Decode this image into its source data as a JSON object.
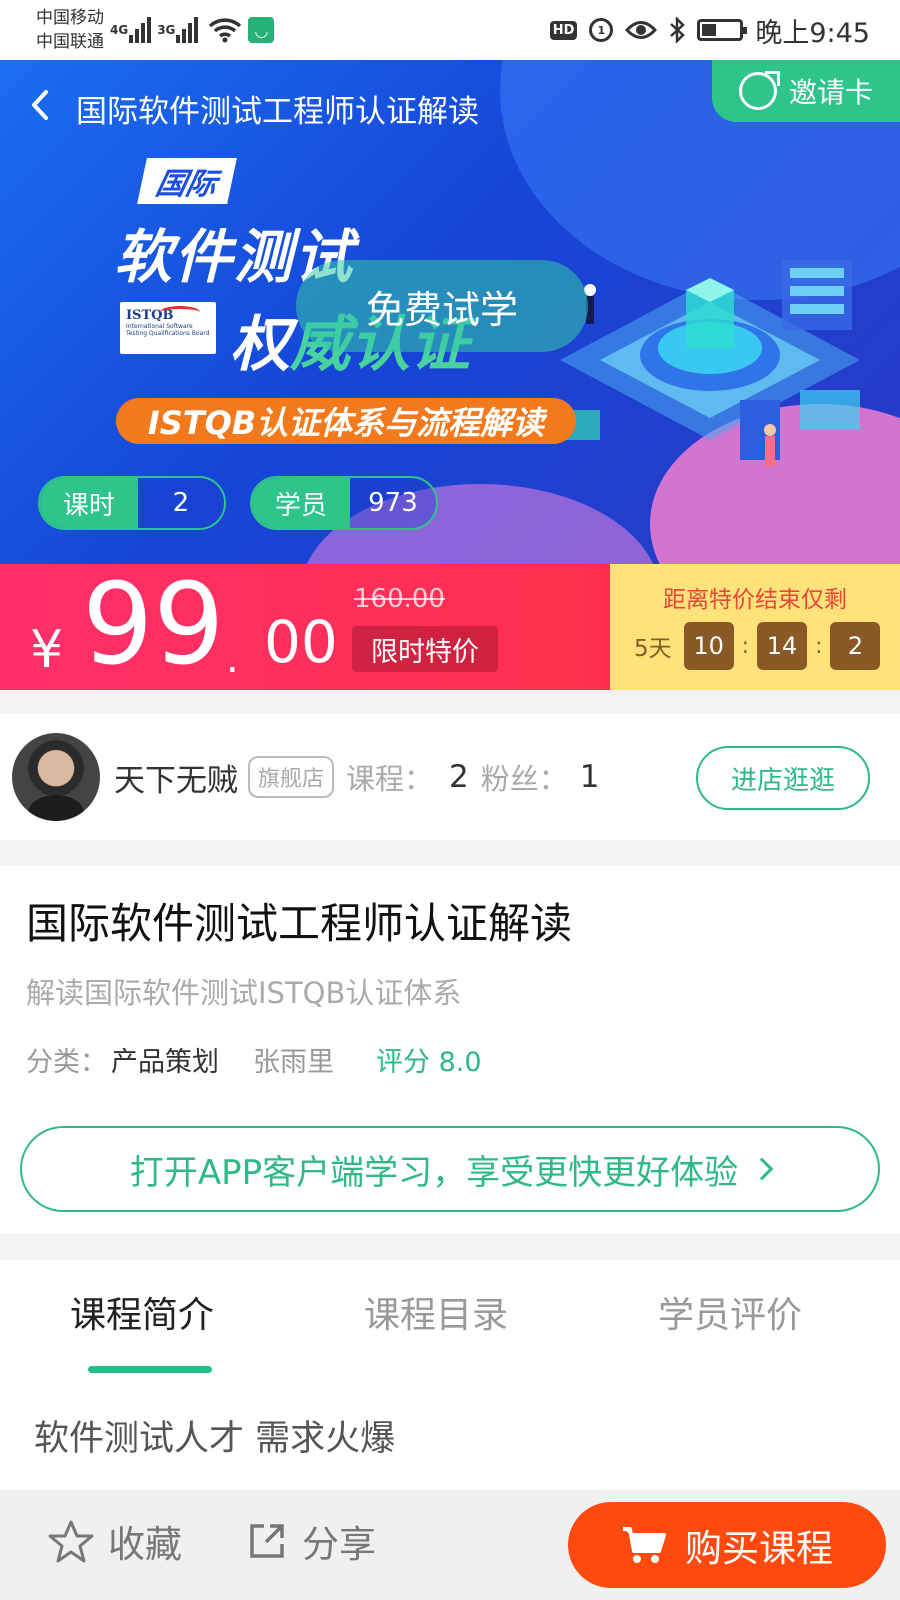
{
  "status_bar": {
    "carrier1": "中国移动",
    "carrier2": "中国联通",
    "net1": "4G",
    "net2": "3G",
    "hd": "HD",
    "time": "晚上9:45"
  },
  "hero": {
    "title": "国际软件测试工程师认证解读",
    "invite_label": "邀请卡",
    "banner_badge": "国际",
    "banner_line1": "软件测试",
    "banner_line2a": "权",
    "banner_line2b": "威认证",
    "istqb_logo": "ISTQB",
    "istqb_sub": "International Software Testing Qualifications Board",
    "trial_label": "免费试学",
    "banner_tagline": "ISTQB认证体系与流程解读",
    "lessons_label": "课时",
    "lessons_value": "2",
    "students_label": "学员",
    "students_value": "973"
  },
  "price": {
    "currency": "¥",
    "integer": "99",
    "dot": ".",
    "decimal": "00",
    "original": "160.00",
    "limited_tag": "限时特价",
    "countdown_title": "距离特价结束仅剩",
    "days": "5天",
    "hours": "10",
    "minutes": "14",
    "seconds": "2",
    "sep": ":"
  },
  "shop": {
    "name": "天下无贼",
    "flag": "旗舰店",
    "courses_label": "课程：",
    "courses_value": "2",
    "fans_label": "粉丝：",
    "fans_value": "1",
    "visit_label": "进店逛逛"
  },
  "course": {
    "title": "国际软件测试工程师认证解读",
    "subtitle": "解读国际软件测试ISTQB认证体系",
    "category_label": "分类：",
    "category_value": "产品策划",
    "teacher": "张雨里",
    "rating": "评分 8.0",
    "open_app": "打开APP客户端学习，享受更快更好体验"
  },
  "tabs": {
    "items": [
      "课程简介",
      "课程目录",
      "学员评价"
    ],
    "active": 0,
    "intro_text": "软件测试人才 需求火爆"
  },
  "bottom": {
    "favorite": "收藏",
    "share": "分享",
    "buy": "购买课程"
  },
  "colors": {
    "accent_green": "#2fb985",
    "price_red": "#ff2f5c",
    "buy_orange": "#ff4a0f",
    "countdown_bg": "#ffe27a"
  }
}
